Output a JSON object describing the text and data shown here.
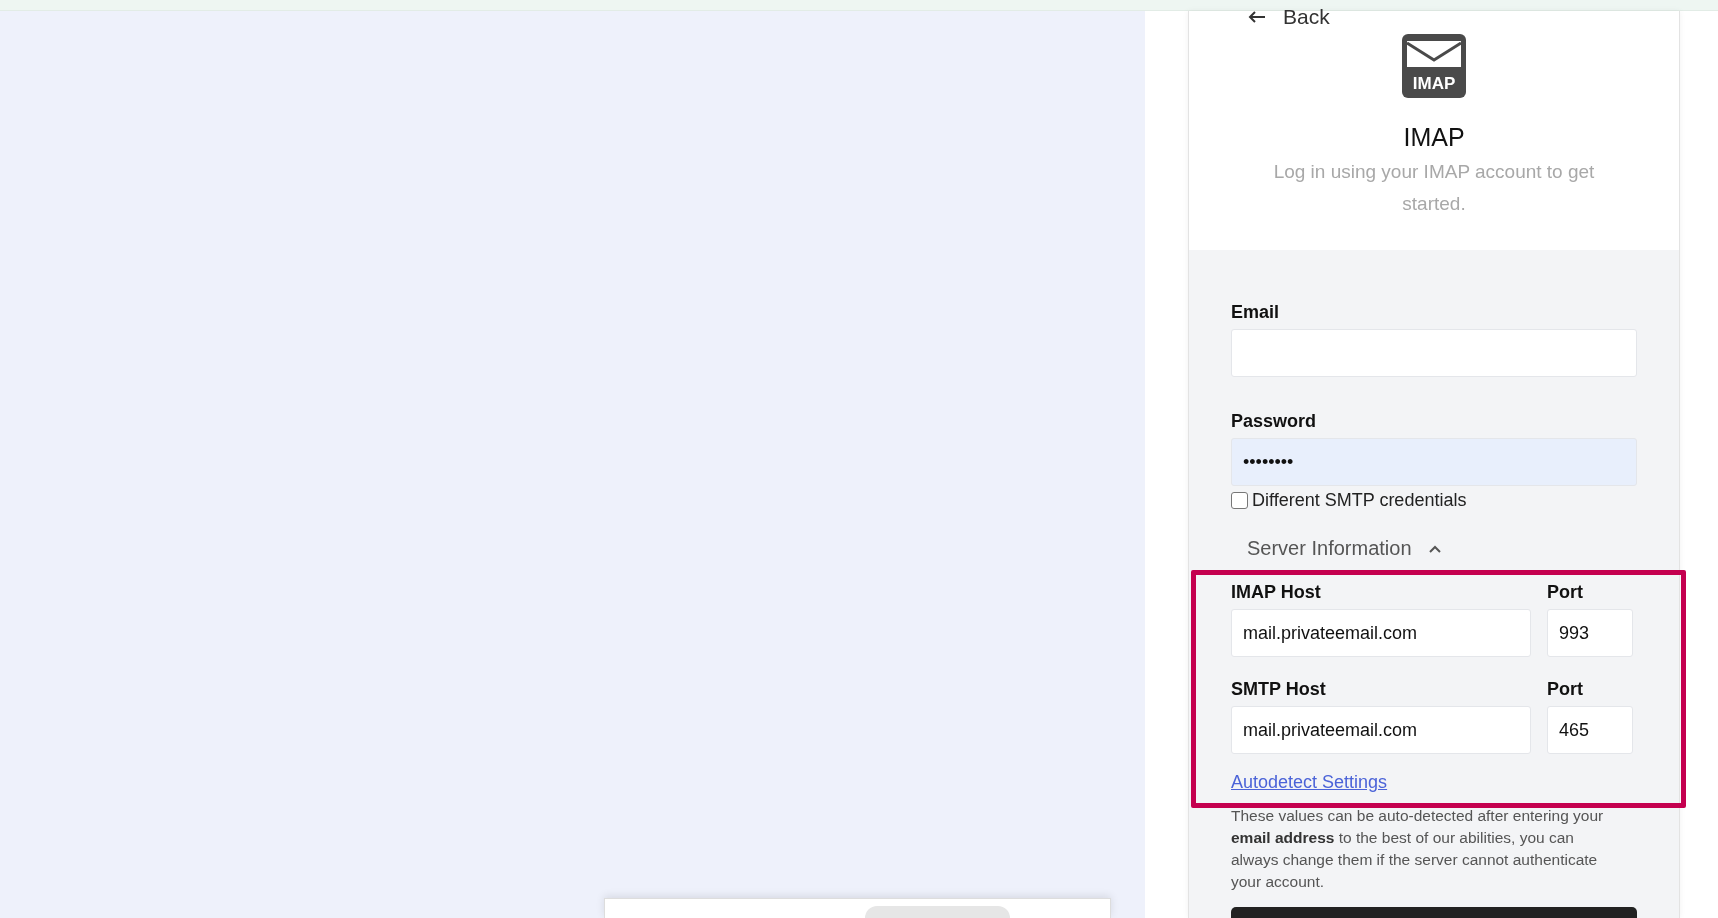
{
  "back": {
    "label": "Back"
  },
  "header": {
    "logo_text": "IMAP",
    "title": "IMAP",
    "subtitle": "Log in using your IMAP account to get started."
  },
  "email": {
    "label": "Email"
  },
  "password": {
    "label": "Password",
    "value": "••••••••"
  },
  "smtp_credentials": {
    "label": "Different SMTP credentials",
    "checked": false
  },
  "server_information": {
    "title": "Server Information",
    "expanded": true,
    "hosts": [
      {
        "label": "IMAP Host",
        "value": "mail.privateemail.com",
        "port_label": "Port",
        "port": "993"
      },
      {
        "label": "SMTP Host",
        "value": "mail.privateemail.com",
        "port_label": "Port",
        "port": "465"
      }
    ],
    "autodetect_link": "Autodetect Settings",
    "help_text": "These values can be auto-detected after entering your **email address** to the best of our abilities, you can always change them if the server cannot authenticate your account."
  }
}
